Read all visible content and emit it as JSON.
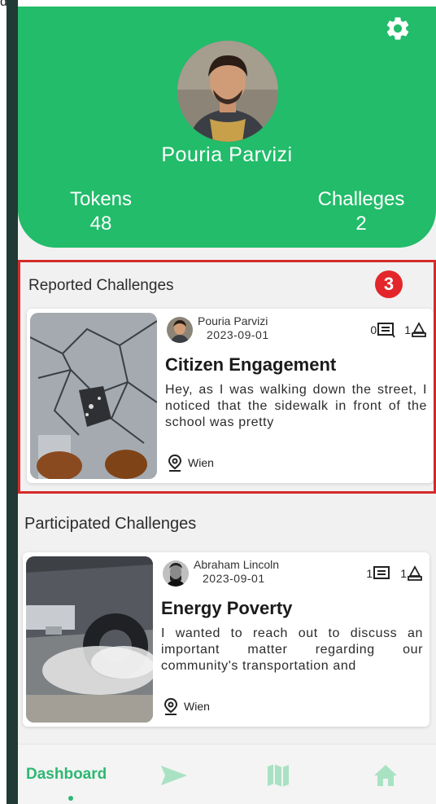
{
  "corner_text": "d",
  "profile": {
    "name": "Pouria Parvizi",
    "tokens_label": "Tokens",
    "tokens_value": "48",
    "challenges_label": "Challeges",
    "challenges_value": "2"
  },
  "reported": {
    "title": "Reported Challenges",
    "badge": "3",
    "card": {
      "author": "Pouria Parvizi",
      "date": "2023-09-01",
      "comments": "0",
      "participants": "1",
      "title": "Citizen Engagement",
      "body": "Hey, as I was walking down the street, I noticed that the sidewalk in front of the school was pretty",
      "location": "Wien"
    }
  },
  "participated": {
    "title": "Participated Challenges",
    "card": {
      "author": "Abraham Lincoln",
      "date": "2023-09-01",
      "comments": "1",
      "participants": "1",
      "title": "Energy Poverty",
      "body": "I wanted to reach out to discuss an important matter regarding our community's transportation and",
      "location": "Wien"
    }
  },
  "nav": {
    "dashboard_label": "Dashboard",
    "icons": [
      "send-icon",
      "map-icon",
      "home-icon"
    ]
  },
  "colors": {
    "brand_green": "#22bc6a",
    "highlight_red": "#d62b2b",
    "nav_active": "#2db872",
    "nav_inactive": "#a9e2c2"
  }
}
